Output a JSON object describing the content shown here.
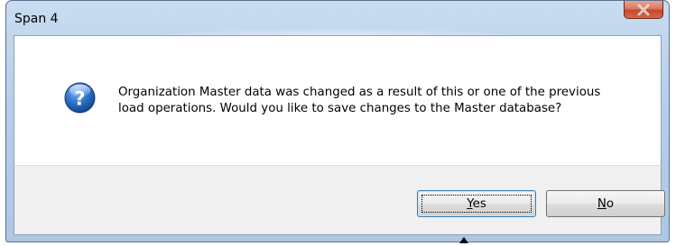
{
  "window": {
    "title": "Span 4",
    "close_label": "Close"
  },
  "message": {
    "icon": "question-icon",
    "text": "Organization Master data was changed as a result of this or one of the previous load operations. Would you like to save changes to the Master database?"
  },
  "buttons": {
    "yes_label": "Yes",
    "yes_accesskey": "Y",
    "no_label": "No",
    "no_accesskey": "N"
  },
  "colors": {
    "frame": "#b7cfea",
    "close_button": "#c7462b",
    "icon_blue": "#1f5fae",
    "footer": "#f0f0f0"
  }
}
